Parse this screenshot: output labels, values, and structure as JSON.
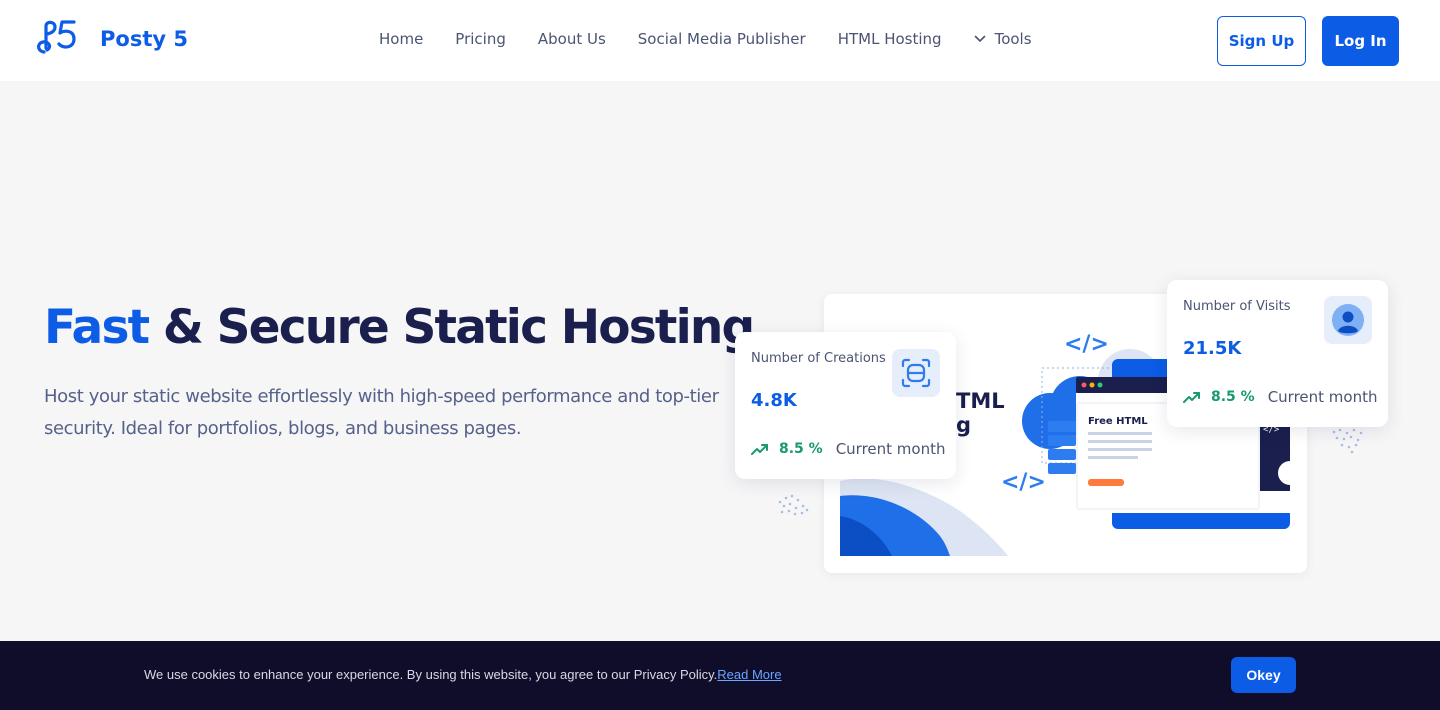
{
  "header": {
    "brand": "Posty 5",
    "nav": [
      {
        "label": "Home"
      },
      {
        "label": "Pricing"
      },
      {
        "label": "About Us"
      },
      {
        "label": "Social Media Publisher"
      },
      {
        "label": "HTML Hosting"
      }
    ],
    "tools_label": "Tools",
    "signup_label": "Sign Up",
    "login_label": "Log In"
  },
  "hero": {
    "title_accent": "Fast",
    "title_rest": " & Secure Static Hosting",
    "description": "Host your static website effortlessly with high-speed performance and top-tier security. Ideal for portfolios, blogs, and business pages."
  },
  "illustration": {
    "free_html_label": "Free HTML",
    "partial_title_1": "TML",
    "partial_title_2": "g",
    "code_tag": "</>"
  },
  "stats": {
    "creations": {
      "label": "Number of Creations",
      "value": "4.8K",
      "trend_pct": "8.5 %",
      "trend_period": "Current month"
    },
    "visits": {
      "label": "Number of Visits",
      "value": "21.5K",
      "trend_pct": "8.5 %",
      "trend_period": "Current month"
    }
  },
  "cookie": {
    "text": "We use cookies to enhance your experience. By using this website, you agree to our Privacy Policy.",
    "link_label": "Read More",
    "button_label": "Okey"
  },
  "colors": {
    "brand_blue": "#0c5ce6",
    "navy": "#1a1f4d",
    "trend_green": "#1a9a6a",
    "cookie_bg": "#0f0d2a"
  },
  "icons": {
    "logo": "posty5-logo-icon",
    "tools_chevron": "chevron-down-icon",
    "creations": "scan-frame-icon",
    "visits": "user-avatar-icon",
    "trend": "trend-up-icon"
  }
}
